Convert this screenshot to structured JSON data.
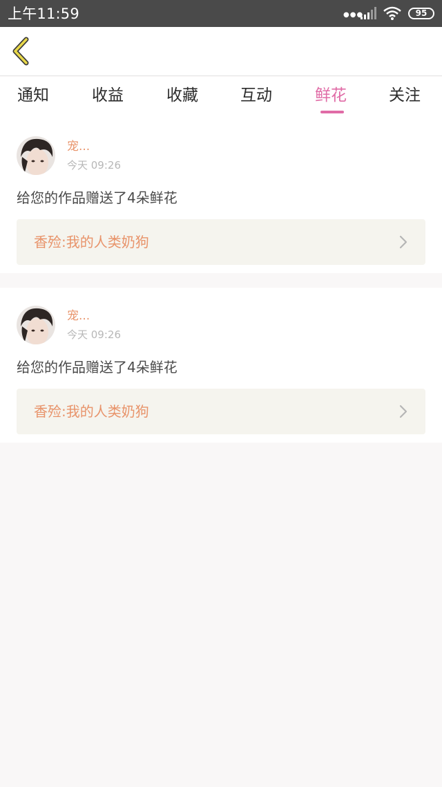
{
  "status_bar": {
    "time": "上午11:59",
    "battery": "95",
    "icons": [
      "dots-icon",
      "signal-icon",
      "wifi-icon",
      "battery-icon"
    ]
  },
  "header": {
    "back_icon": "back-chevron-icon",
    "accent_color": "#e8d84a"
  },
  "tabs": [
    {
      "label": "通知",
      "active": false
    },
    {
      "label": "收益",
      "active": false
    },
    {
      "label": "收藏",
      "active": false
    },
    {
      "label": "互动",
      "active": false
    },
    {
      "label": "鲜花",
      "active": true
    },
    {
      "label": "关注",
      "active": false
    }
  ],
  "colors": {
    "active_tab": "#e06ba6",
    "username": "#e8936a",
    "link_bg": "#f5f4ee"
  },
  "notifications": [
    {
      "username": "宠...",
      "time": "今天 09:26",
      "message": "给您的作品赠送了4朵鲜花",
      "work_title": "香殓:我的人类奶狗"
    },
    {
      "username": "宠...",
      "time": "今天 09:26",
      "message": "给您的作品赠送了4朵鲜花",
      "work_title": "香殓:我的人类奶狗"
    }
  ]
}
